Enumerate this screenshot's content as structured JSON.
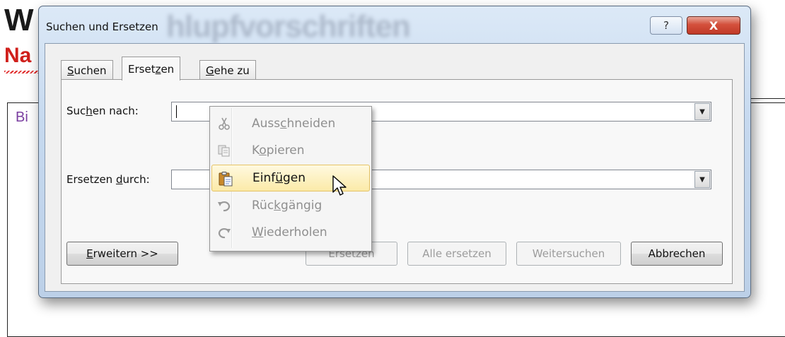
{
  "background_doc": {
    "heading": "W",
    "subheading": "Na",
    "box_text": "Bi"
  },
  "dialog": {
    "title": "Suchen und Ersetzen",
    "help_label": "?",
    "close_label": "X",
    "tabs": [
      {
        "label_pre": "",
        "label_u": "S",
        "label_post": "uchen"
      },
      {
        "label_pre": "Erset",
        "label_u": "z",
        "label_post": "en"
      },
      {
        "label_pre": "",
        "label_u": "G",
        "label_post": "ehe zu"
      }
    ],
    "find": {
      "label_pre": "Suc",
      "label_u": "h",
      "label_post": "en nach:",
      "value": ""
    },
    "replace": {
      "label_pre": "Ersetzen ",
      "label_u": "d",
      "label_post": "urch:",
      "value": ""
    },
    "buttons": {
      "more_u": "E",
      "more_post": "rweitern >>",
      "replace": "Ersetzen",
      "replace_all": "Alle ersetzen",
      "find_next": "Weitersuchen",
      "cancel": "Abbrechen"
    }
  },
  "context_menu": {
    "items": [
      {
        "pre": "Auss",
        "u": "c",
        "post": "hneiden",
        "icon": "scissors-icon",
        "enabled": false
      },
      {
        "pre": "K",
        "u": "o",
        "post": "pieren",
        "icon": "copy-icon",
        "enabled": false
      },
      {
        "pre": "Einf",
        "u": "ü",
        "post": "gen",
        "icon": "paste-icon",
        "enabled": true,
        "hovered": true
      },
      {
        "pre": "Rüc",
        "u": "k",
        "post": "gängig",
        "icon": "undo-icon",
        "enabled": false
      },
      {
        "pre": "",
        "u": "W",
        "post": "iederholen",
        "icon": "redo-icon",
        "enabled": false
      }
    ]
  },
  "colors": {
    "close_button": "#c03a28",
    "hover_highlight": "#fbeaa8",
    "subheading": "#d0201c"
  }
}
